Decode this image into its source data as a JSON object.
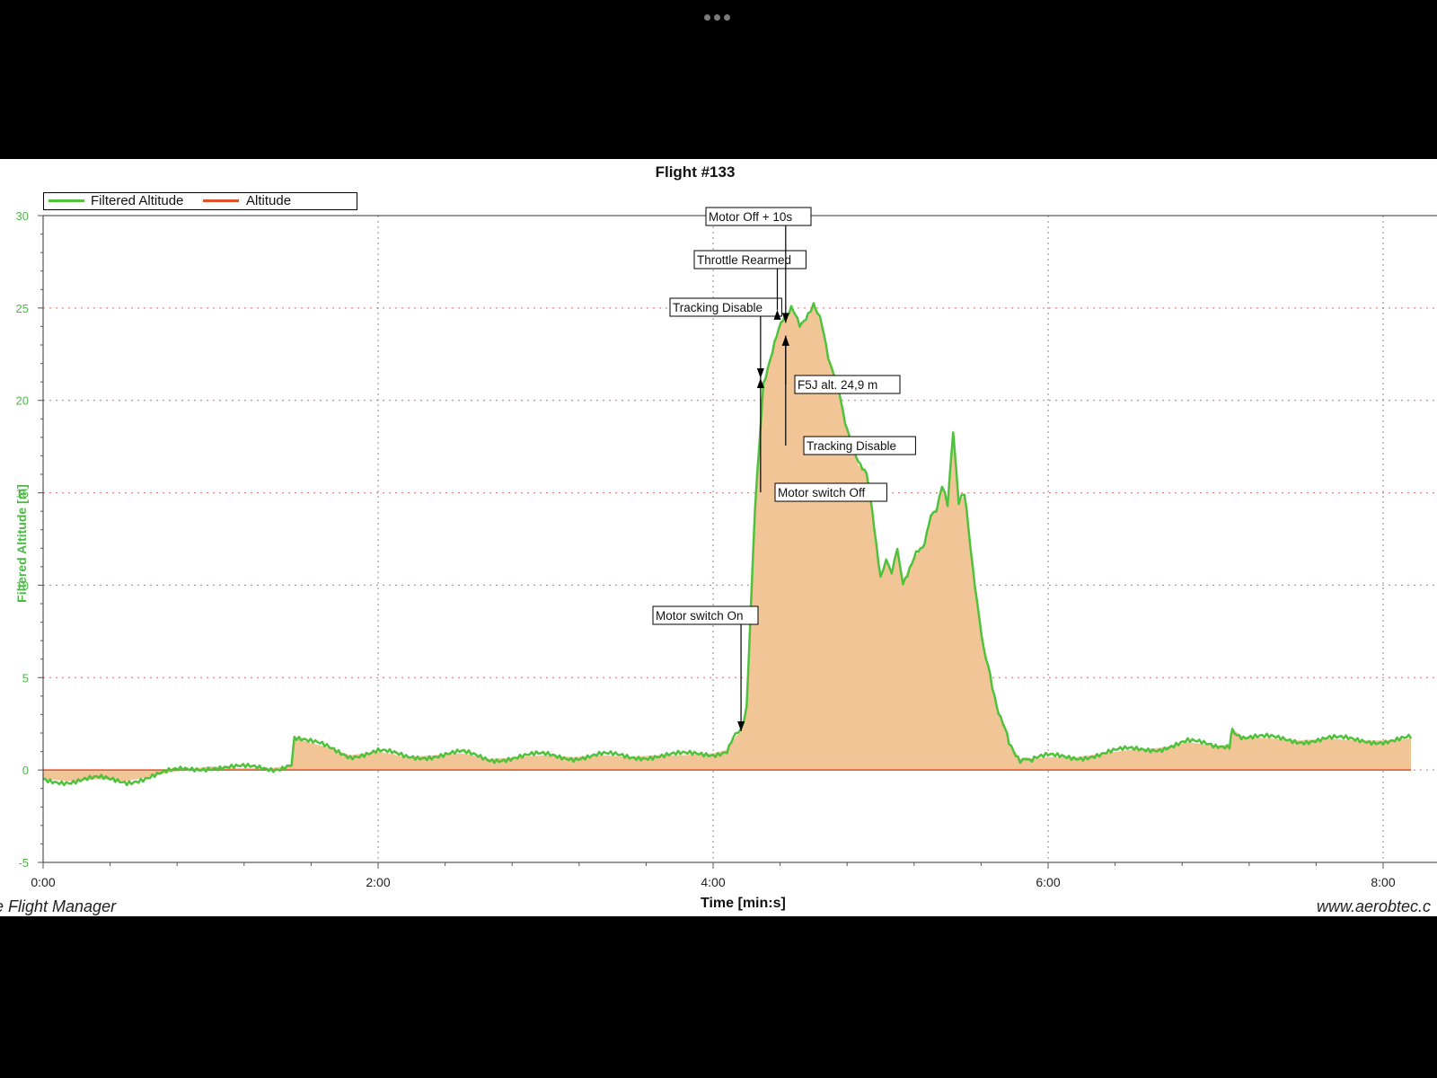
{
  "window": {
    "menu_icon": "ellipsis-icon"
  },
  "colors": {
    "filtered": "#4fc23c",
    "altitude": "#e0512a",
    "fill": "#f2c597",
    "grid": "#e06a6a",
    "ytick": "#4db848"
  },
  "chart_data": {
    "type": "area",
    "title": "Flight #133",
    "xlabel": "Time [min:s]",
    "ylabel": "Filtered Altitude [m]",
    "xlim": [
      0,
      490
    ],
    "ylim": [
      -5,
      30
    ],
    "x_ticks": [
      {
        "v": 0,
        "label": "0:00"
      },
      {
        "v": 120,
        "label": "2:00"
      },
      {
        "v": 240,
        "label": "4:00"
      },
      {
        "v": 360,
        "label": "6:00"
      },
      {
        "v": 480,
        "label": "8:00"
      }
    ],
    "y_ticks": [
      {
        "v": -5,
        "label": "-5"
      },
      {
        "v": 0,
        "label": "0"
      },
      {
        "v": 5,
        "label": "5"
      },
      {
        "v": 10,
        "label": "10"
      },
      {
        "v": 15,
        "label": "15"
      },
      {
        "v": 20,
        "label": "20"
      },
      {
        "v": 25,
        "label": "25"
      },
      {
        "v": 30,
        "label": "30"
      }
    ],
    "legend": [
      "Filtered Altitude",
      "Altitude"
    ],
    "legend_position": "top-left",
    "grid": "dotted horizontal, dotted vertical at major ticks",
    "series": [
      {
        "name": "Filtered Altitude",
        "x": [
          0,
          10,
          20,
          30,
          40,
          50,
          60,
          70,
          80,
          89,
          90,
          95,
          100,
          110,
          120,
          130,
          140,
          150,
          160,
          170,
          180,
          190,
          200,
          210,
          220,
          230,
          240,
          245,
          248,
          250,
          252,
          255,
          258,
          262,
          265,
          268,
          271,
          274,
          276,
          279,
          282,
          285,
          288,
          292,
          295,
          297,
          300,
          302,
          304,
          306,
          308,
          312,
          315,
          318,
          320,
          322,
          324,
          326,
          328,
          330,
          333,
          337,
          340,
          343,
          346,
          350,
          352,
          355,
          360,
          370,
          380,
          390,
          400,
          410,
          420,
          425,
          426,
          430,
          440,
          450,
          460,
          470,
          480,
          490
        ],
        "y": [
          -0.5,
          -0.6,
          -0.5,
          -0.6,
          -0.3,
          0,
          0.2,
          0.1,
          0.1,
          0.2,
          1.8,
          1.5,
          1.3,
          0.8,
          1.0,
          0.7,
          0.8,
          0.9,
          0.6,
          0.7,
          0.8,
          0.7,
          0.8,
          0.7,
          0.8,
          0.8,
          0.9,
          1.1,
          1.8,
          2.1,
          3.5,
          14,
          21,
          23,
          24.5,
          24.9,
          24.2,
          24.5,
          25.3,
          24,
          22,
          20.5,
          18.5,
          16.5,
          16.2,
          14,
          10.5,
          11.5,
          10.5,
          12,
          10.2,
          11.5,
          12,
          13.8,
          14.2,
          15.3,
          14.3,
          18.5,
          14.4,
          14.9,
          11,
          6.5,
          4.5,
          2.8,
          1.5,
          0.6,
          0.7,
          0.6,
          0.7,
          0.7,
          0.9,
          1.1,
          1.2,
          1.5,
          1.3,
          1.4,
          2.2,
          1.8,
          1.7,
          1.6,
          1.7,
          1.6,
          1.6,
          1.7
        ]
      },
      {
        "name": "Altitude",
        "x": [
          0,
          490
        ],
        "y": [
          0,
          0
        ]
      }
    ],
    "annotations": [
      {
        "text": "Motor switch On",
        "x": 250,
        "y": 2.1,
        "dir": "down"
      },
      {
        "text": "Tracking Disable",
        "x": 257,
        "y": 21.2,
        "dir": "down"
      },
      {
        "text": "Motor switch Off",
        "x": 257,
        "y": 21.2,
        "dir": "up"
      },
      {
        "text": "Throttle Rearmed",
        "x": 263,
        "y": 24.9,
        "dir": "up"
      },
      {
        "text": "Motor Off + 10s",
        "x": 266,
        "y": 24.2,
        "dir": "down"
      },
      {
        "text": "F5J alt. 24,9 m",
        "x": 266,
        "y": 23.5,
        "dir": "up"
      },
      {
        "text": "Tracking Disable",
        "x": 266,
        "y": 23.5,
        "dir": "up"
      }
    ]
  },
  "footer": {
    "left": "e Flight Manager",
    "right": "www.aerobtec.c"
  }
}
